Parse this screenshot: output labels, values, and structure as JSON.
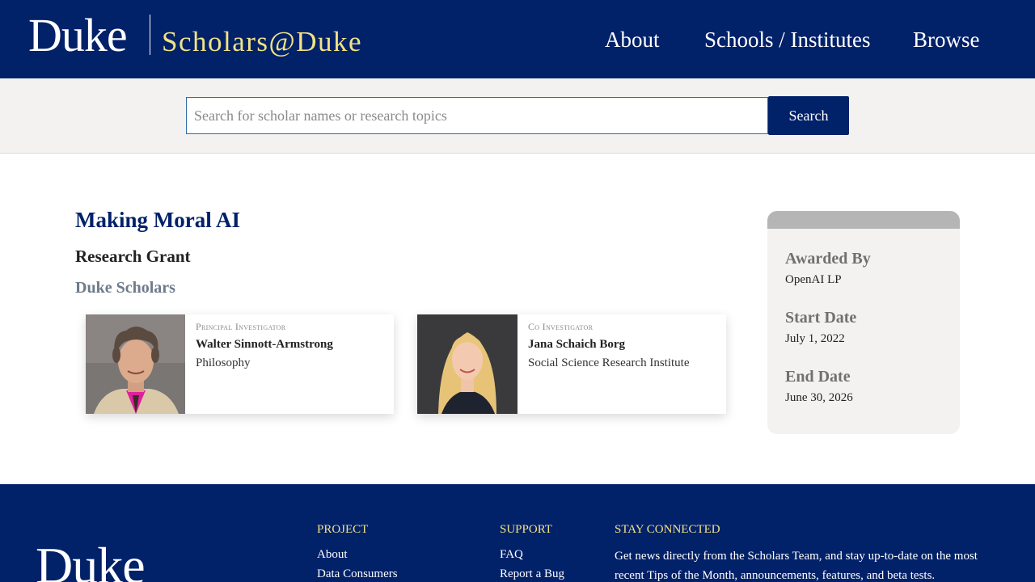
{
  "header": {
    "logo_text": "Duke",
    "site_name": "Scholars@Duke",
    "nav": [
      "About",
      "Schools / Institutes",
      "Browse"
    ]
  },
  "search": {
    "placeholder": "Search for scholar names or research topics",
    "button_label": "Search"
  },
  "grant": {
    "title": "Making Moral AI",
    "type": "Research Grant",
    "section_label": "Duke Scholars",
    "people": [
      {
        "role": "Principal Investigator",
        "name": "Walter Sinnott-Armstrong",
        "department": "Philosophy"
      },
      {
        "role": "Co Investigator",
        "name": "Jana Schaich Borg",
        "department": "Social Science Research Institute"
      }
    ]
  },
  "details": {
    "awarded_by_label": "Awarded By",
    "awarded_by": "OpenAI LP",
    "start_label": "Start Date",
    "start_date": "July 1, 2022",
    "end_label": "End Date",
    "end_date": "June 30, 2026"
  },
  "footer": {
    "logo_text": "Duke",
    "project_heading": "PROJECT",
    "project_links": [
      "About",
      "Data Consumers"
    ],
    "support_heading": "SUPPORT",
    "support_links": [
      "FAQ",
      "Report a Bug"
    ],
    "stay_heading": "STAY CONNECTED",
    "stay_text": "Get news directly from the Scholars Team, and stay up-to-date on the most recent Tips of the Month, announcements, features, and beta tests."
  },
  "colors": {
    "duke_navy": "#012169",
    "accent_yellow": "#f2e285",
    "panel_gray": "#f3f2f1"
  }
}
